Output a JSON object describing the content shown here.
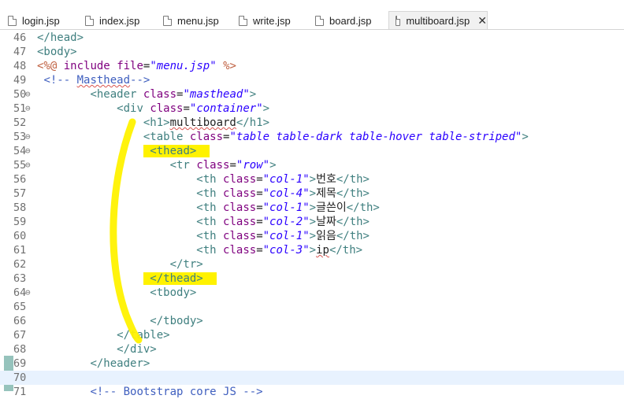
{
  "tabs": [
    {
      "label": "login.jsp",
      "active": false
    },
    {
      "label": "index.jsp",
      "active": false
    },
    {
      "label": "menu.jsp",
      "active": false
    },
    {
      "label": "write.jsp",
      "active": false
    },
    {
      "label": "board.jsp",
      "active": false
    },
    {
      "label": "multiboard.jsp",
      "active": true
    }
  ],
  "editor": {
    "current_line": 70,
    "lines": [
      {
        "n": "46",
        "fold": false,
        "html": "<span class=\"tg\">&lt;/head&gt;</span>"
      },
      {
        "n": "47",
        "fold": false,
        "html": "<span class=\"tg\">&lt;body&gt;</span>"
      },
      {
        "n": "48",
        "fold": false,
        "html": "<span class=\"jsp\">&lt;%@</span> <span class=\"at\">include</span> <span class=\"at\">file</span>=<span class=\"av\">\"menu.jsp\"</span> <span class=\"jsp\">%&gt;</span>"
      },
      {
        "n": "49",
        "fold": false,
        "html": " <span class=\"cm\">&lt;!-- <span class=\"uline\">Masthead</span>--&gt;</span>"
      },
      {
        "n": "50",
        "fold": true,
        "html": "        <span class=\"tg\">&lt;header</span> <span class=\"at\">class</span>=<span class=\"av\">\"masthead\"</span><span class=\"tg\">&gt;</span>"
      },
      {
        "n": "51",
        "fold": true,
        "html": "            <span class=\"tg\">&lt;div</span> <span class=\"at\">class</span>=<span class=\"av\">\"container\"</span><span class=\"tg\">&gt;</span>"
      },
      {
        "n": "52",
        "fold": false,
        "html": "                <span class=\"tg\">&lt;h1&gt;</span><span class=\"uline\">multiboard</span><span class=\"tg\">&lt;/h1&gt;</span>"
      },
      {
        "n": "53",
        "fold": true,
        "html": "                <span class=\"tg\">&lt;table</span> <span class=\"at\">class</span>=<span class=\"av\">\"table table-dark table-hover table-striped\"</span><span class=\"tg\">&gt;</span>"
      },
      {
        "n": "54",
        "fold": true,
        "html": "                <span class=\"hl\"> <span class=\"tg\">&lt;thead&gt;</span>  </span>"
      },
      {
        "n": "55",
        "fold": true,
        "html": "                    <span class=\"tg\">&lt;tr</span> <span class=\"at\">class</span>=<span class=\"av\">\"row\"</span><span class=\"tg\">&gt;</span>"
      },
      {
        "n": "56",
        "fold": false,
        "html": "                        <span class=\"tg\">&lt;th</span> <span class=\"at\">class</span>=<span class=\"av\">\"col-1\"</span><span class=\"tg\">&gt;</span>번호<span class=\"tg\">&lt;/th&gt;</span>"
      },
      {
        "n": "57",
        "fold": false,
        "html": "                        <span class=\"tg\">&lt;th</span> <span class=\"at\">class</span>=<span class=\"av\">\"col-4\"</span><span class=\"tg\">&gt;</span>제목<span class=\"tg\">&lt;/th&gt;</span>"
      },
      {
        "n": "58",
        "fold": false,
        "html": "                        <span class=\"tg\">&lt;th</span> <span class=\"at\">class</span>=<span class=\"av\">\"col-1\"</span><span class=\"tg\">&gt;</span>글쓴이<span class=\"tg\">&lt;/th&gt;</span>"
      },
      {
        "n": "59",
        "fold": false,
        "html": "                        <span class=\"tg\">&lt;th</span> <span class=\"at\">class</span>=<span class=\"av\">\"col-2\"</span><span class=\"tg\">&gt;</span>날짜<span class=\"tg\">&lt;/th&gt;</span>"
      },
      {
        "n": "60",
        "fold": false,
        "html": "                        <span class=\"tg\">&lt;th</span> <span class=\"at\">class</span>=<span class=\"av\">\"col-1\"</span><span class=\"tg\">&gt;</span>읽음<span class=\"tg\">&lt;/th&gt;</span>"
      },
      {
        "n": "61",
        "fold": false,
        "html": "                        <span class=\"tg\">&lt;th</span> <span class=\"at\">class</span>=<span class=\"av\">\"col-3\"</span><span class=\"tg\">&gt;</span><span class=\"uline\">ip</span><span class=\"tg\">&lt;/th&gt;</span>"
      },
      {
        "n": "62",
        "fold": false,
        "html": "                    <span class=\"tg\">&lt;/tr&gt;</span>"
      },
      {
        "n": "63",
        "fold": false,
        "html": "                <span class=\"hl\"> <span class=\"tg\">&lt;/thead&gt;</span>  </span>"
      },
      {
        "n": "64",
        "fold": true,
        "html": "                 <span class=\"tg\">&lt;tbody&gt;</span>"
      },
      {
        "n": "65",
        "fold": false,
        "html": ""
      },
      {
        "n": "66",
        "fold": false,
        "html": "                 <span class=\"tg\">&lt;/tbody&gt;</span>"
      },
      {
        "n": "67",
        "fold": false,
        "html": "            <span class=\"tg\">&lt;/table&gt;</span>"
      },
      {
        "n": "68",
        "fold": false,
        "html": "            <span class=\"tg\">&lt;/div&gt;</span>"
      },
      {
        "n": "69",
        "fold": false,
        "html": "        <span class=\"tg\">&lt;/header&gt;</span>"
      },
      {
        "n": "70",
        "fold": false,
        "html": ""
      },
      {
        "n": "71",
        "fold": false,
        "html": "        <span class=\"cm\">&lt;!-- Bootstrap core JS --&gt;</span>"
      }
    ]
  },
  "colors": {
    "highlighter": "#fff200",
    "tag": "#3f7f7f",
    "attr": "#7f007f",
    "value": "#2a00ff",
    "comment": "#3f5fbf"
  }
}
